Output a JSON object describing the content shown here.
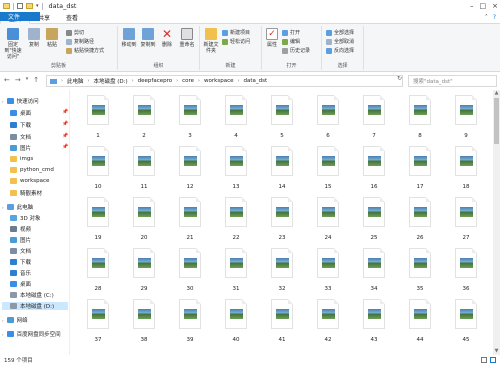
{
  "window": {
    "title": "data_dst"
  },
  "tabs": [
    {
      "label": "文件"
    },
    {
      "label": "主页"
    },
    {
      "label": "共享"
    },
    {
      "label": "查看"
    }
  ],
  "ribbon": {
    "clipboard": {
      "label": "剪贴板",
      "pin": "固定到\"快速访问\"",
      "copy": "复制",
      "paste": "粘贴",
      "cut": "剪切",
      "copy_path": "复制路径",
      "paste_shortcut": "粘贴快捷方式"
    },
    "organize": {
      "label": "组织",
      "move_to": "移动到",
      "copy_to": "复制到",
      "delete": "删除",
      "rename": "重命名"
    },
    "new": {
      "label": "新建",
      "new_folder": "新建文件夹",
      "new_item": "新建项目",
      "easy_access": "轻松访问"
    },
    "open": {
      "label": "打开",
      "properties": "属性",
      "open": "打开",
      "edit": "编辑",
      "history": "历史记录"
    },
    "select": {
      "label": "选择",
      "select_all": "全部选择",
      "select_none": "全部取消",
      "invert": "反向选择"
    }
  },
  "address": {
    "crumbs": [
      "此电脑",
      "本地磁盘 (D:)",
      "deepfacepro",
      "core",
      "workspace",
      "data_dst"
    ],
    "search_placeholder": "搜索\"data_dst\""
  },
  "sidebar": {
    "quick_access": "快速访问",
    "items": [
      {
        "label": "桌面",
        "icon": "desktop-icon",
        "color": "#3a8ee6",
        "pinned": true
      },
      {
        "label": "下载",
        "icon": "download-icon",
        "color": "#2f7fd1",
        "pinned": true
      },
      {
        "label": "文档",
        "icon": "document-icon",
        "color": "#7c8ea3",
        "pinned": true
      },
      {
        "label": "图片",
        "icon": "picture-icon",
        "color": "#4a9bd6",
        "pinned": true
      },
      {
        "label": "imgs",
        "icon": "folder-icon",
        "color": "#f2c04c",
        "pinned": false
      },
      {
        "label": "python_cmd",
        "icon": "folder-icon",
        "color": "#f2c04c",
        "pinned": false
      },
      {
        "label": "workspace",
        "icon": "folder-icon",
        "color": "#f2c04c",
        "pinned": false
      },
      {
        "label": "騎觀素材",
        "icon": "folder-icon",
        "color": "#f2c04c",
        "pinned": false
      }
    ],
    "this_pc": "此电脑",
    "pc_items": [
      {
        "label": "3D 对象",
        "icon": "3d-objects-icon",
        "color": "#55a6e0"
      },
      {
        "label": "视频",
        "icon": "video-icon",
        "color": "#6d7b8c"
      },
      {
        "label": "图片",
        "icon": "picture-icon",
        "color": "#4a9bd6"
      },
      {
        "label": "文档",
        "icon": "document-icon",
        "color": "#7c8ea3"
      },
      {
        "label": "下载",
        "icon": "download-icon",
        "color": "#2f7fd1"
      },
      {
        "label": "音乐",
        "icon": "music-icon",
        "color": "#2f7fd1"
      },
      {
        "label": "桌面",
        "icon": "desktop-icon",
        "color": "#3a8ee6"
      },
      {
        "label": "本地磁盘 (C:)",
        "icon": "drive-icon",
        "color": "#8a98a8"
      },
      {
        "label": "本地磁盘 (D:)",
        "icon": "drive-icon",
        "color": "#8a98a8"
      }
    ],
    "network": "网络",
    "baidu": "百度网盘同步空间"
  },
  "files": [
    "1",
    "2",
    "3",
    "4",
    "5",
    "6",
    "7",
    "8",
    "9",
    "10",
    "11",
    "12",
    "13",
    "14",
    "15",
    "16",
    "17",
    "18",
    "19",
    "20",
    "21",
    "22",
    "23",
    "24",
    "25",
    "26",
    "27",
    "28",
    "29",
    "30",
    "31",
    "32",
    "33",
    "34",
    "35",
    "36",
    "37",
    "38",
    "39",
    "40",
    "41",
    "42",
    "43",
    "44",
    "45"
  ],
  "status": {
    "count": "159 个项目"
  }
}
